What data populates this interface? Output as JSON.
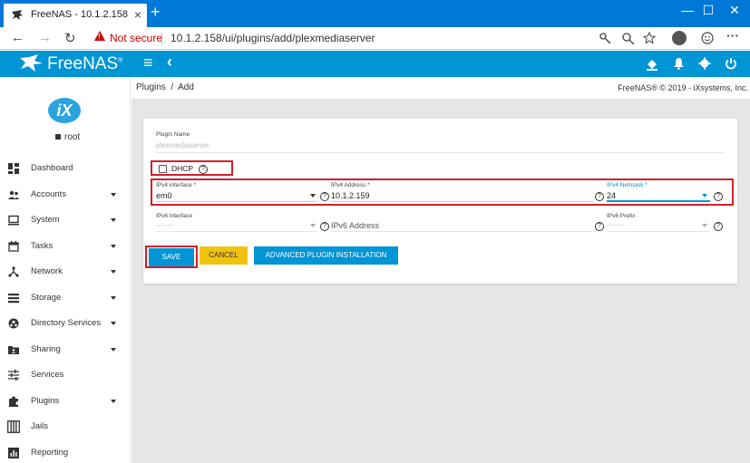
{
  "browser": {
    "tab_title": "FreeNAS - 10.1.2.158",
    "tab_close": "×",
    "new_tab": "+",
    "minimize": "—",
    "maximize": "☐",
    "close": "✕",
    "back": "←",
    "forward": "→",
    "reload": "↻",
    "security_label": "Not secure",
    "url": "10.1.2.158/ui/plugins/add/plexmediaserver"
  },
  "app": {
    "logo_text": "FreeNAS",
    "logo_mark": "®",
    "brand_color": "#0095d5",
    "menu_icon": "≡",
    "collapse_icon": "‹"
  },
  "user": {
    "name": "root",
    "logo_text": "iX"
  },
  "sidebar": {
    "items": [
      {
        "label": "Dashboard",
        "icon": "dashboard-icon",
        "expandable": false
      },
      {
        "label": "Accounts",
        "icon": "accounts-icon",
        "expandable": true
      },
      {
        "label": "System",
        "icon": "system-icon",
        "expandable": true
      },
      {
        "label": "Tasks",
        "icon": "tasks-icon",
        "expandable": true
      },
      {
        "label": "Network",
        "icon": "network-icon",
        "expandable": true
      },
      {
        "label": "Storage",
        "icon": "storage-icon",
        "expandable": true
      },
      {
        "label": "Directory Services",
        "icon": "directory-services-icon",
        "expandable": true
      },
      {
        "label": "Sharing",
        "icon": "sharing-icon",
        "expandable": true
      },
      {
        "label": "Services",
        "icon": "services-icon",
        "expandable": false
      },
      {
        "label": "Plugins",
        "icon": "plugins-icon",
        "expandable": true
      },
      {
        "label": "Jails",
        "icon": "jails-icon",
        "expandable": false
      },
      {
        "label": "Reporting",
        "icon": "reporting-icon",
        "expandable": false
      }
    ]
  },
  "breadcrumb": {
    "text": "Plugins  /  Add"
  },
  "copyright": "FreeNAS® © 2019 - iXsystems, Inc.",
  "form": {
    "plugin_name": {
      "label": "Plugin Name",
      "value": "plexmediaserver"
    },
    "dhcp": {
      "label": "DHCP",
      "checked": false
    },
    "ipv4_interface": {
      "label": "IPv4 interface *",
      "value": "em0"
    },
    "ipv4_address": {
      "label": "IPv4 Address *",
      "value": "10.1.2.159"
    },
    "ipv4_netmask": {
      "label": "IPv4 Netmask *",
      "value": "24"
    },
    "ipv6_interface": {
      "label": "IPv6 Interface",
      "placeholder": "--------"
    },
    "ipv6_address": {
      "placeholder": "IPv6 Address"
    },
    "ipv6_prefix": {
      "label": "IPv6 Prefix",
      "placeholder": "--------"
    },
    "help_glyph": "?",
    "buttons": {
      "save": "SAVE",
      "cancel": "CANCEL",
      "advanced": "ADVANCED PLUGIN INSTALLATION"
    },
    "colors": {
      "save": "#0095d5",
      "cancel": "#f0c30f",
      "advanced": "#0095d5",
      "highlight": "#d0202a"
    }
  }
}
